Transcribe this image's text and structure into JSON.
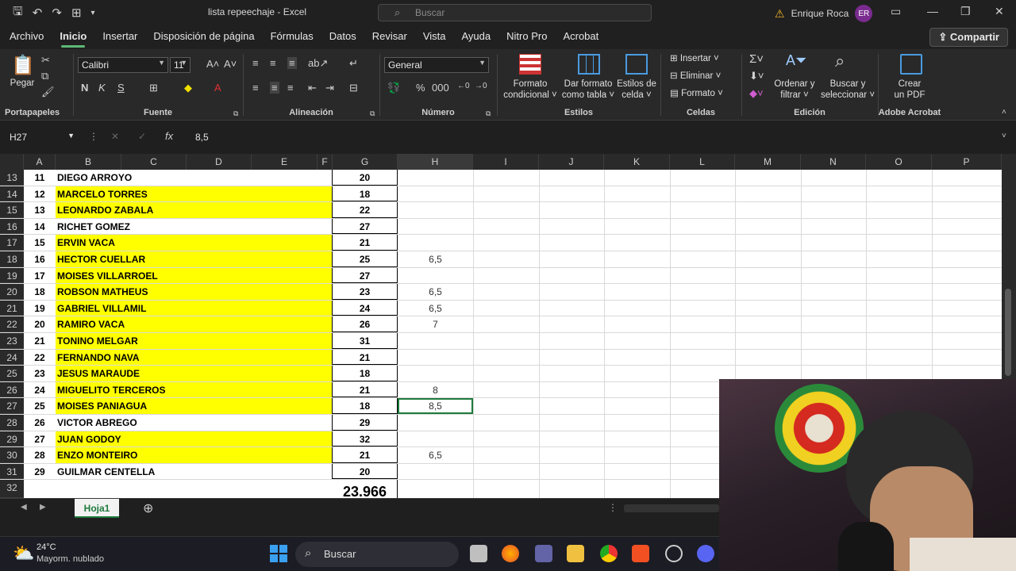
{
  "title_bar": {
    "document_title": "lista repeechaje  -  Excel",
    "search_placeholder": "Buscar",
    "user_name": "Enrique Roca",
    "user_initials": "ER"
  },
  "menu": {
    "tabs": [
      "Archivo",
      "Inicio",
      "Insertar",
      "Disposición de página",
      "Fórmulas",
      "Datos",
      "Revisar",
      "Vista",
      "Ayuda",
      "Nitro Pro",
      "Acrobat"
    ],
    "active": "Inicio",
    "share_label": "Compartir"
  },
  "ribbon": {
    "portapapeles": {
      "label": "Portapapeles",
      "paste": "Pegar"
    },
    "fuente": {
      "label": "Fuente",
      "font": "Calibri",
      "size": "11",
      "bold": "N",
      "italic": "K",
      "underline": "S"
    },
    "alineacion": {
      "label": "Alineación"
    },
    "numero": {
      "label": "Número",
      "format": "General"
    },
    "estilos": {
      "label": "Estilos",
      "cond_format_1": "Formato",
      "cond_format_2": "condicional",
      "table_format_1": "Dar formato",
      "table_format_2": "como tabla",
      "cell_styles_1": "Estilos de",
      "cell_styles_2": "celda"
    },
    "celdas": {
      "label": "Celdas",
      "insert": "Insertar",
      "delete": "Eliminar",
      "format": "Formato"
    },
    "edicion": {
      "label": "Edición",
      "sort_1": "Ordenar y",
      "sort_2": "filtrar",
      "find_1": "Buscar y",
      "find_2": "seleccionar"
    },
    "acrobat": {
      "label": "Adobe Acrobat",
      "create_1": "Crear",
      "create_2": "un PDF"
    }
  },
  "formula_bar": {
    "name_box": "H27",
    "fx": "fx",
    "content": "8,5"
  },
  "columns": [
    "A",
    "B",
    "C",
    "D",
    "E",
    "F",
    "G",
    "H",
    "I",
    "J",
    "K",
    "L",
    "M",
    "N",
    "O",
    "P"
  ],
  "rows": [
    {
      "row": "13",
      "num": "11",
      "name": "DIEGO ARROYO",
      "score": "20",
      "extra": "",
      "yellow": false
    },
    {
      "row": "14",
      "num": "12",
      "name": "MARCELO TORRES",
      "score": "18",
      "extra": "",
      "yellow": true
    },
    {
      "row": "15",
      "num": "13",
      "name": "LEONARDO ZABALA",
      "score": "22",
      "extra": "",
      "yellow": true
    },
    {
      "row": "16",
      "num": "14",
      "name": "RICHET GOMEZ",
      "score": "27",
      "extra": "",
      "yellow": false
    },
    {
      "row": "17",
      "num": "15",
      "name": "ERVIN VACA",
      "score": "21",
      "extra": "",
      "yellow": true
    },
    {
      "row": "18",
      "num": "16",
      "name": "HECTOR CUELLAR",
      "score": "25",
      "extra": "6,5",
      "yellow": true
    },
    {
      "row": "19",
      "num": "17",
      "name": "MOISES VILLARROEL",
      "score": "27",
      "extra": "",
      "yellow": true
    },
    {
      "row": "20",
      "num": "18",
      "name": "ROBSON MATHEUS",
      "score": "23",
      "extra": "6,5",
      "yellow": true
    },
    {
      "row": "21",
      "num": "19",
      "name": "GABRIEL VILLAMIL",
      "score": "24",
      "extra": "6,5",
      "yellow": true
    },
    {
      "row": "22",
      "num": "20",
      "name": "RAMIRO VACA",
      "score": "26",
      "extra": "7",
      "yellow": true
    },
    {
      "row": "23",
      "num": "21",
      "name": "TONINO MELGAR",
      "score": "31",
      "extra": "",
      "yellow": true
    },
    {
      "row": "24",
      "num": "22",
      "name": "FERNANDO NAVA",
      "score": "21",
      "extra": "",
      "yellow": true
    },
    {
      "row": "25",
      "num": "23",
      "name": "JESUS MARAUDE",
      "score": "18",
      "extra": "",
      "yellow": true
    },
    {
      "row": "26",
      "num": "24",
      "name": "MIGUELITO TERCEROS",
      "score": "21",
      "extra": "8",
      "yellow": true
    },
    {
      "row": "27",
      "num": "25",
      "name": "MOISES PANIAGUA",
      "score": "18",
      "extra": "8,5",
      "yellow": true
    },
    {
      "row": "28",
      "num": "26",
      "name": "VICTOR ABREGO",
      "score": "29",
      "extra": "",
      "yellow": false
    },
    {
      "row": "29",
      "num": "27",
      "name": "JUAN GODOY",
      "score": "32",
      "extra": "",
      "yellow": true
    },
    {
      "row": "30",
      "num": "28",
      "name": "ENZO MONTEIRO",
      "score": "21",
      "extra": "6,5",
      "yellow": true
    },
    {
      "row": "31",
      "num": "29",
      "name": "GUILMAR CENTELLA",
      "score": "20",
      "extra": "",
      "yellow": false
    }
  ],
  "partial_row": {
    "row": "32",
    "total": "23.966"
  },
  "sheet": {
    "tab": "Hoja1"
  },
  "taskbar": {
    "weather_temp": "24°C",
    "weather_desc": "Mayorm. nublado",
    "search_label": "Buscar"
  },
  "colors": {
    "highlight": "#ffff00",
    "accent": "#5fb878",
    "sheet_tab": "#1e7a3c"
  }
}
